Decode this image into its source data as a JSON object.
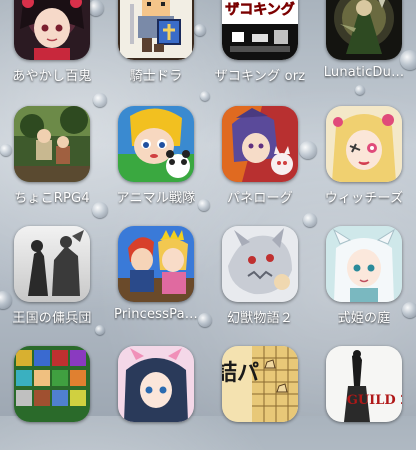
{
  "home_screen": {
    "rows": [
      [
        {
          "label": "あやかし百鬼",
          "icon": "ayakashi-hyakki-icon"
        },
        {
          "label": "騎士ドラ",
          "icon": "kishi-dora-icon"
        },
        {
          "label": "ザコキング orz",
          "icon": "zako-king-icon",
          "icon_text": "ザコキング"
        },
        {
          "label": "LunaticDu…",
          "icon": "lunatic-dungeon-icon"
        }
      ],
      [
        {
          "label": "ちょこRPG4",
          "icon": "choco-rpg4-icon"
        },
        {
          "label": "アニマル戦隊",
          "icon": "animal-sentai-icon"
        },
        {
          "label": "パネローグ",
          "icon": "panerogue-icon"
        },
        {
          "label": "ウィッチーズ",
          "icon": "witches-icon"
        }
      ],
      [
        {
          "label": "王国の傭兵団",
          "icon": "oukoku-youheidan-icon"
        },
        {
          "label": "PrincessPa…",
          "icon": "princess-party-icon"
        },
        {
          "label": "幻獣物語２",
          "icon": "genjuu-monogatari-2-icon"
        },
        {
          "label": "式姫の庭",
          "icon": "shikihime-no-niwa-icon"
        }
      ],
      [
        {
          "label": "",
          "icon": "pixel-heroes-icon"
        },
        {
          "label": "",
          "icon": "anime-girl-icon"
        },
        {
          "label": "",
          "icon": "tsume-shogi-icon",
          "icon_text": "詰パ"
        },
        {
          "label": "",
          "icon": "guild-2-icon",
          "icon_text": "GUILD 2"
        }
      ]
    ]
  },
  "colors": {
    "label_text": "#ffffff",
    "wallpaper": "#b3bcc6"
  }
}
